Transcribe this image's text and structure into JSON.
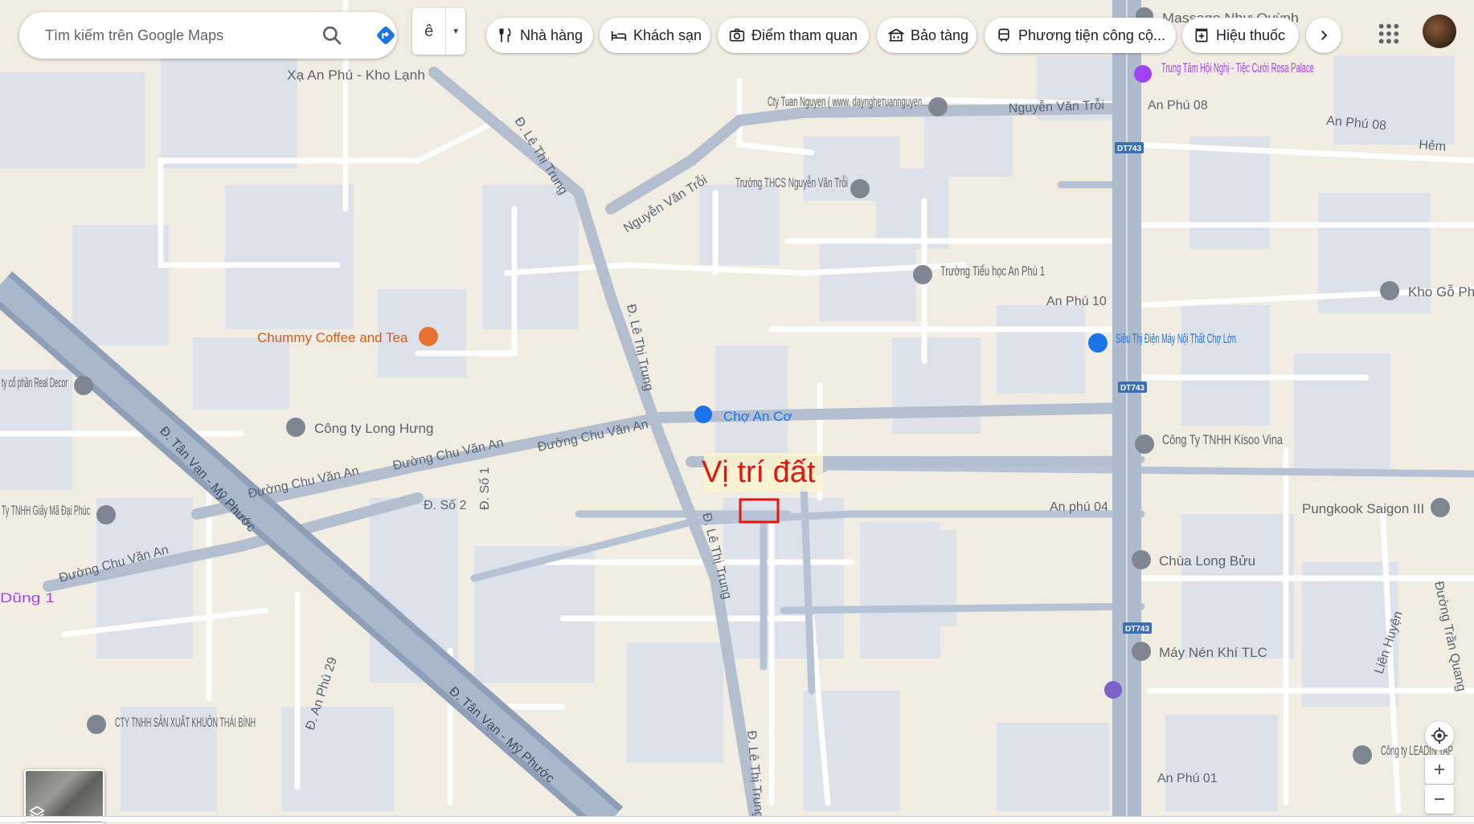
{
  "search": {
    "placeholder": "Tìm kiếm trên Google Maps"
  },
  "ime": {
    "label": "ê"
  },
  "chips": [
    {
      "label": "Nhà hàng",
      "icon": "restaurant-icon"
    },
    {
      "label": "Khách sạn",
      "icon": "hotel-icon"
    },
    {
      "label": "Điểm tham quan",
      "icon": "camera-icon"
    },
    {
      "label": "Bảo tàng",
      "icon": "museum-icon"
    },
    {
      "label": "Phương tiện công cộ...",
      "icon": "transit-icon"
    },
    {
      "label": "Hiệu thuốc",
      "icon": "pharmacy-icon"
    }
  ],
  "annotation": {
    "label": "Vị trí đất",
    "color": "#e5140c"
  },
  "places": [
    {
      "name": "Chummy Coffee and Tea",
      "type": "cafe",
      "color": "#e8712f"
    },
    {
      "name": "Chợ An Cơ",
      "type": "market",
      "color": "#1a73e8"
    },
    {
      "name": "Siêu Thị Điện Máy Nội Thất Chợ Lớn",
      "type": "shopping",
      "color": "#1a73e8"
    },
    {
      "name": "Trung Tâm Hội Nghị - Tiệc Cưới Rosa Palace",
      "type": "venue",
      "color": "#a142f4"
    },
    {
      "name": "Cty Tuan Nguyen ( www. dayngheтuannguyen...",
      "type": "school",
      "color": "#5f6368"
    },
    {
      "name": "Trường THCS Nguyễn Văn Trỗi",
      "type": "school",
      "color": "#5f6368"
    },
    {
      "name": "Trường Tiểu học An Phú 1",
      "type": "school",
      "color": "#5f6368"
    },
    {
      "name": "Công ty Long Hưng",
      "type": "business",
      "color": "#5f6368"
    },
    {
      "name": "Công Ty TNHH Kisoo Vina",
      "type": "business",
      "color": "#5f6368"
    },
    {
      "name": "Pungkook Saigon III",
      "type": "business",
      "color": "#5f6368"
    },
    {
      "name": "Chùa Long Bửu",
      "type": "temple",
      "color": "#5f6368"
    },
    {
      "name": "Máy Nén Khí TLC",
      "type": "business",
      "color": "#5f6368"
    },
    {
      "name": "CTY TNHH SẢN XUẤT KHUÔN THÁI BÌNH",
      "type": "business",
      "color": "#5f6368"
    },
    {
      "name": "Kho Gỗ Ph",
      "type": "business",
      "color": "#5f6368"
    },
    {
      "name": "ty cổ phần Real Decor",
      "type": "business",
      "color": "#5f6368"
    },
    {
      "name": "Ty TNHH Giấy Mã Đại Phúc",
      "type": "business",
      "color": "#5f6368"
    },
    {
      "name": "Công ty LEADIN TAP",
      "type": "business",
      "color": "#5f6368"
    },
    {
      "name": "Massage Như Quỳnh",
      "type": "business",
      "color": "#5f6368"
    },
    {
      "name": "Dũng 1",
      "type": "business",
      "color": "#a142f4"
    },
    {
      "name": "Xạ An Phú - Kho Lạnh",
      "type": "business",
      "color": "#5f6368"
    }
  ],
  "roads": {
    "tan_van": "Đ. Tân Vạn - Mỹ Phước",
    "le_thi_trung": "Đ. Lê Thị Trung",
    "chu_van_an": "Đường Chu Văn An",
    "nguyen_van_troi": "Nguyễn Văn Trỗi",
    "an_phu_08": "An Phú 08",
    "an_phu_10": "An Phú 10",
    "an_phu_04": "An phú 04",
    "an_phu_01": "An Phú 01",
    "an_phu_29": "Đ. An Phú 29",
    "so_1": "Đ. Số 1",
    "so_2": "Đ. Số 2",
    "hem": "Hẻm",
    "lien_huyen": "Liên Huyện",
    "tran_quang": "Đường Trần Quang",
    "dt743": "DT743"
  }
}
